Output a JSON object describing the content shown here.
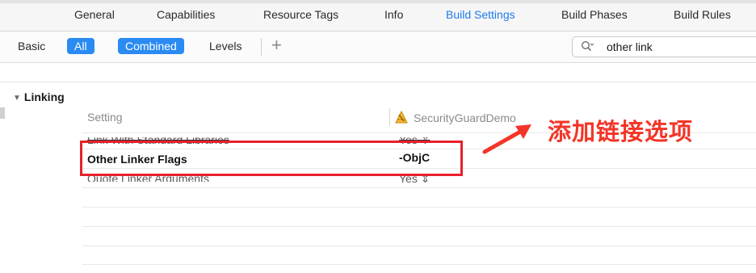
{
  "tabs": [
    {
      "label": "General"
    },
    {
      "label": "Capabilities"
    },
    {
      "label": "Resource Tags"
    },
    {
      "label": "Info"
    },
    {
      "label": "Build Settings",
      "active": true
    },
    {
      "label": "Build Phases"
    },
    {
      "label": "Build Rules"
    }
  ],
  "filter": {
    "basic": "Basic",
    "all": "All",
    "combined": "Combined",
    "levels": "Levels",
    "add": "+"
  },
  "search": {
    "value": "other link",
    "icon": "magnifier-with-dropdown-icon"
  },
  "section": {
    "title": "Linking",
    "disclosure": "▼"
  },
  "columns": {
    "setting": "Setting",
    "target": "SecurityGuardDemo",
    "target_icon": "app-target-icon"
  },
  "rows": [
    {
      "setting": "Link With Standard Libraries",
      "value": "Yes",
      "control": "stepper"
    },
    {
      "setting": "Other Linker Flags",
      "value": "-ObjC",
      "highlighted": true
    },
    {
      "setting": "Quote Linker Arguments",
      "value": "Yes",
      "control": "stepper"
    }
  ],
  "annotation": {
    "text": "添加链接选项",
    "color": "#f33528"
  },
  "colors": {
    "accent": "#2a8bf2",
    "active_tab": "#1e7cf0",
    "highlight_box": "#e8202a"
  }
}
